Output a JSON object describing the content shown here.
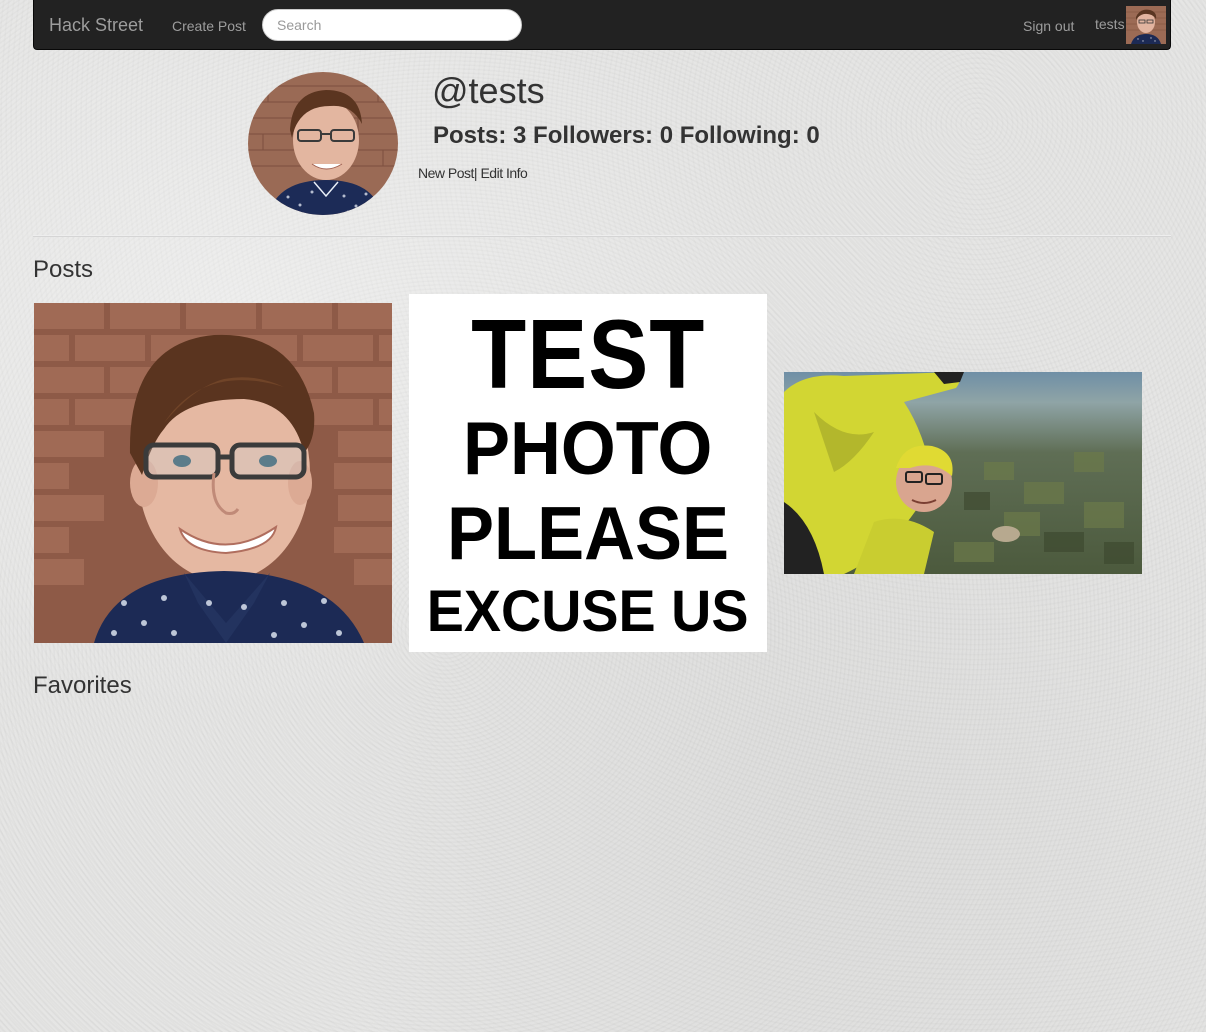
{
  "navbar": {
    "brand": "Hack Street",
    "create_post_label": "Create Post",
    "search_placeholder": "Search",
    "search_value": "",
    "sign_out_label": "Sign out",
    "username_label": "tests"
  },
  "profile": {
    "handle": "@tests",
    "stats_text": "Posts: 3 Followers: 0 Following: 0",
    "posts_count": 3,
    "followers_count": 0,
    "following_count": 0,
    "new_post_label": "New Post",
    "separator": "|",
    "edit_info_label": "Edit Info"
  },
  "sections": {
    "posts_title": "Posts",
    "favorites_title": "Favorites"
  },
  "posts": [
    {
      "image": "portrait-photo"
    },
    {
      "image": "test-photo-sign",
      "lines": [
        "TEST",
        "PHOTO",
        "PLEASE",
        "EXCUSE US"
      ]
    },
    {
      "image": "skydiving-photo"
    }
  ],
  "colors": {
    "navbar_bg": "#222222",
    "navbar_text": "#9d9d9d",
    "page_bg": "#e4e4e3",
    "text": "#333333"
  }
}
